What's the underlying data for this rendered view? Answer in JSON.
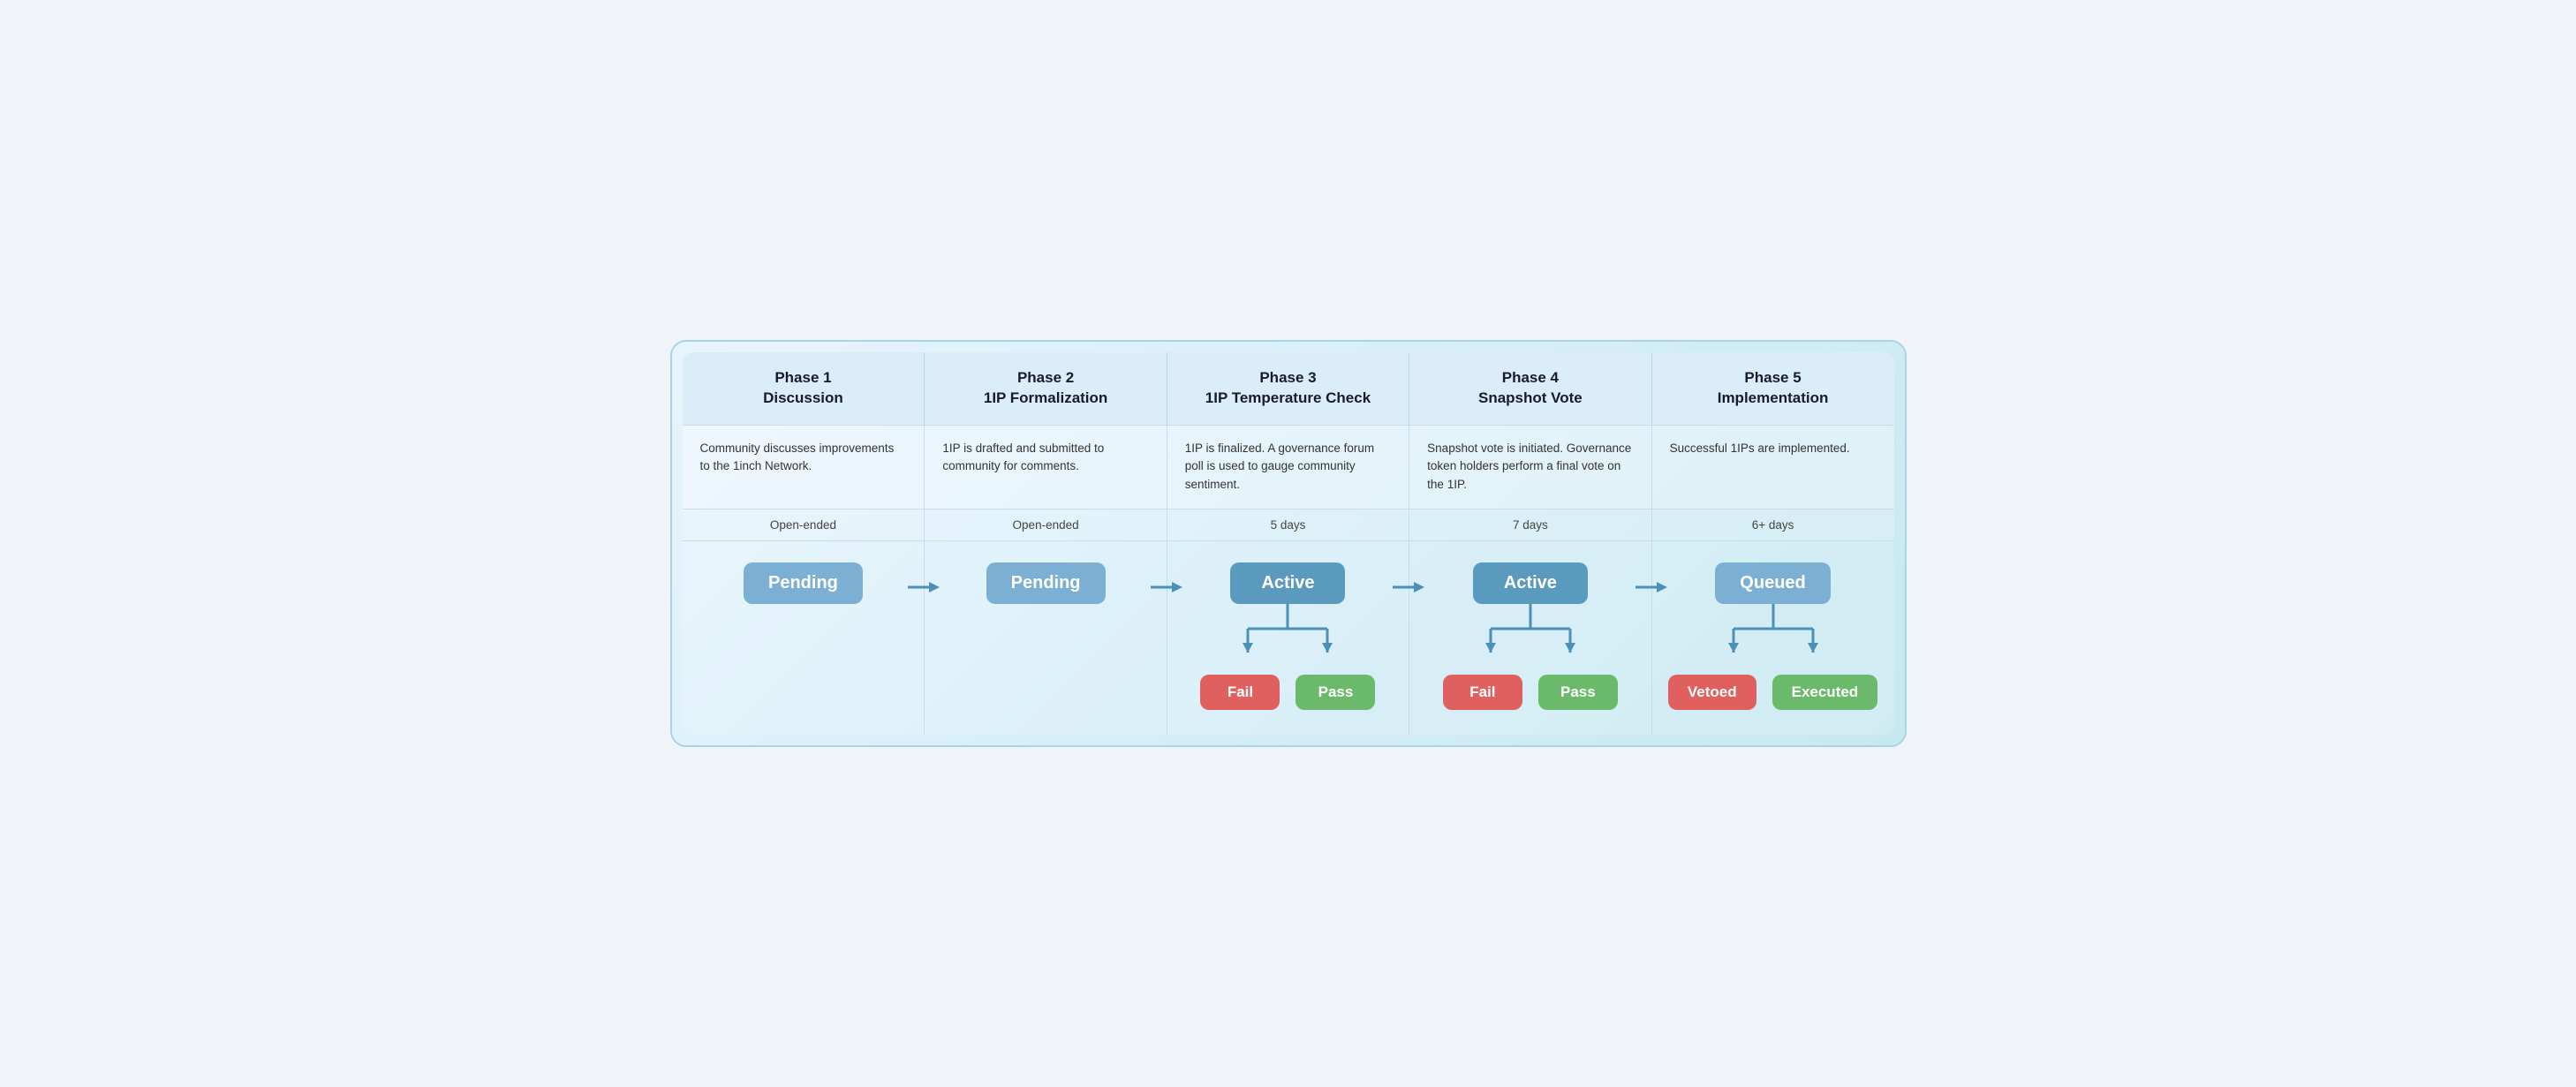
{
  "phases": [
    {
      "id": "phase1",
      "title": "Phase 1\nDiscussion",
      "description": "Community discusses improvements to the 1inch Network.",
      "duration": "Open-ended",
      "status": "Pending",
      "statusClass": "status-pending",
      "hasBranch": false,
      "hasArrowAfter": true
    },
    {
      "id": "phase2",
      "title": "Phase 2\n1IP Formalization",
      "description": "1IP is drafted and submitted to community for comments.",
      "duration": "Open-ended",
      "status": "Pending",
      "statusClass": "status-pending",
      "hasBranch": false,
      "hasArrowAfter": true
    },
    {
      "id": "phase3",
      "title": "Phase 3\n1IP Temperature Check",
      "description": "1IP is finalized. A governance forum poll is used to gauge community sentiment.",
      "duration": "5 days",
      "status": "Active",
      "statusClass": "status-active",
      "hasBranch": true,
      "branch": [
        "Fail",
        "Pass"
      ],
      "branchClasses": [
        "status-fail",
        "status-pass"
      ],
      "hasArrowAfter": true
    },
    {
      "id": "phase4",
      "title": "Phase 4\nSnapshot Vote",
      "description": "Snapshot vote is initiated. Governance token holders perform a final vote on the 1IP.",
      "duration": "7 days",
      "status": "Active",
      "statusClass": "status-active",
      "hasBranch": true,
      "branch": [
        "Fail",
        "Pass"
      ],
      "branchClasses": [
        "status-fail",
        "status-pass"
      ],
      "hasArrowAfter": true
    },
    {
      "id": "phase5",
      "title": "Phase 5\nImplementation",
      "description": "Successful 1IPs are implemented.",
      "duration": "6+ days",
      "status": "Queued",
      "statusClass": "status-queued",
      "hasBranch": true,
      "branch": [
        "Vetoed",
        "Executed"
      ],
      "branchClasses": [
        "status-vetoed",
        "status-executed"
      ],
      "hasArrowAfter": false
    }
  ],
  "arrowColor": "#4a90b8"
}
